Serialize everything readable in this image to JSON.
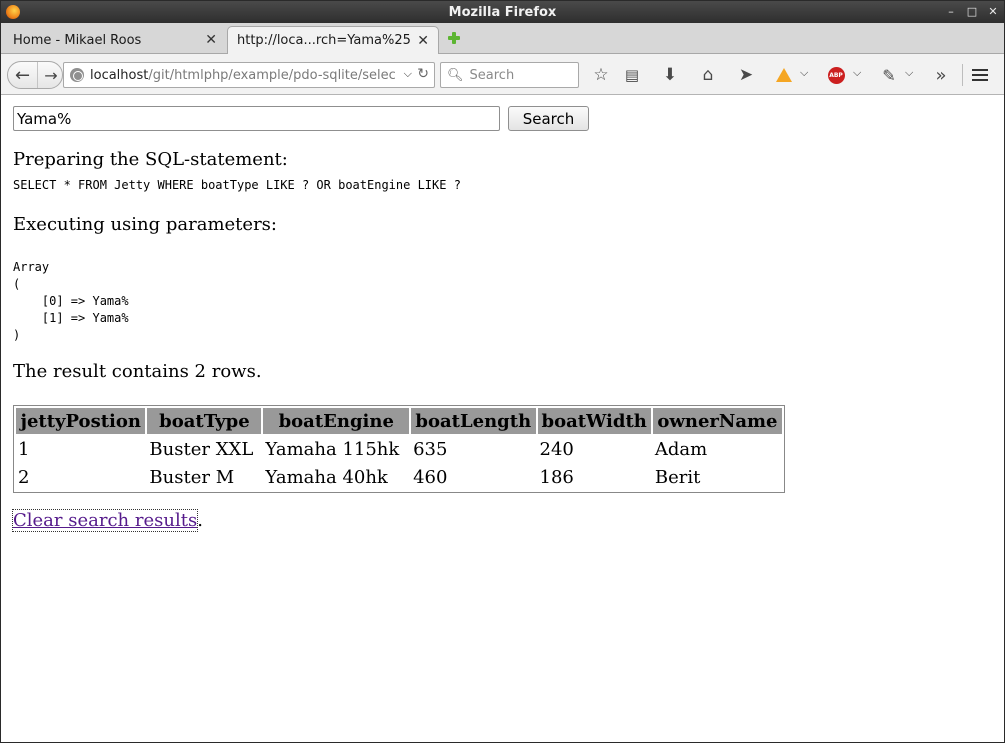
{
  "window": {
    "title": "Mozilla Firefox"
  },
  "tabs": [
    {
      "label": "Home - Mikael Roos",
      "active": false
    },
    {
      "label": "http://loca...rch=Yama%25",
      "active": true
    }
  ],
  "navbar": {
    "url_host": "localhost",
    "url_rest": "/git/htmlphp/example/pdo-sqlite/selec",
    "search_placeholder": "Search"
  },
  "page": {
    "search_value": "Yama%",
    "search_button": "Search",
    "preparing_heading": "Preparing the SQL-statement:",
    "sql": "SELECT * FROM Jetty WHERE boatType LIKE ? OR boatEngine LIKE ?",
    "executing_heading": "Executing using parameters:",
    "params_dump": "Array\n(\n    [0] => Yama%\n    [1] => Yama%\n)",
    "result_summary": "The result contains 2 rows.",
    "table": {
      "headers": [
        "jettyPostion",
        "boatType",
        "boatEngine",
        "boatLength",
        "boatWidth",
        "ownerName"
      ],
      "rows": [
        [
          "1",
          "Buster XXL",
          "Yamaha 115hk",
          "635",
          "240",
          "Adam"
        ],
        [
          "2",
          "Buster M",
          "Yamaha 40hk",
          "460",
          "186",
          "Berit"
        ]
      ]
    },
    "clear_link": "Clear search results",
    "clear_suffix": "."
  },
  "colors": {
    "table_header_bg": "#999999",
    "link": "#551a8b"
  }
}
